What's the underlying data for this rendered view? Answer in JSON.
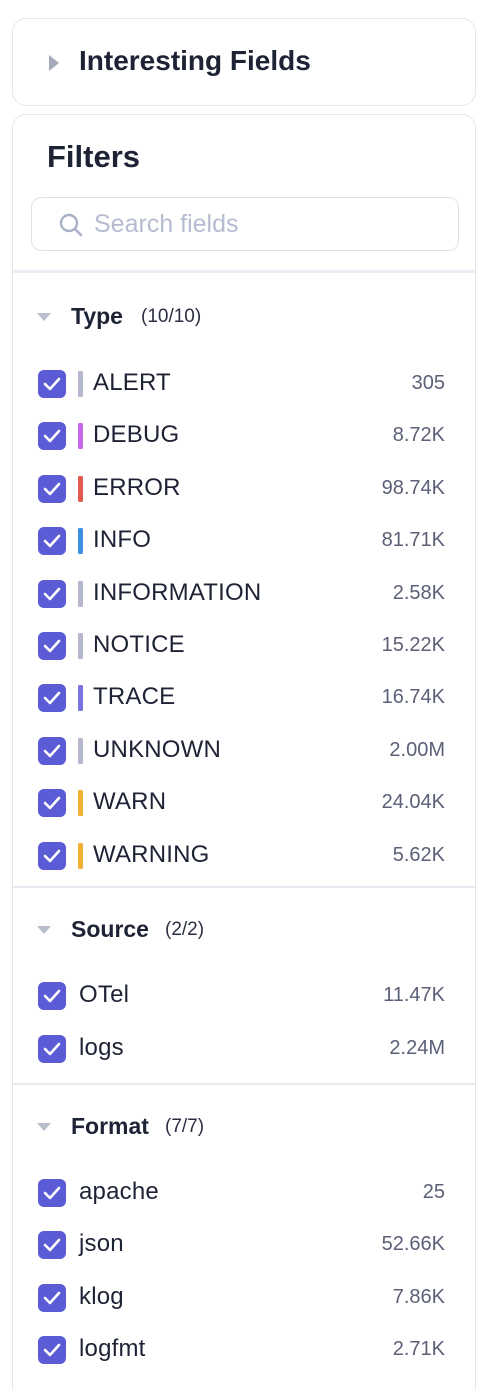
{
  "interesting_fields": {
    "title": "Interesting Fields"
  },
  "filters": {
    "title": "Filters",
    "search": {
      "placeholder": "Search fields",
      "value": ""
    }
  },
  "sections": {
    "type": {
      "label": "Type",
      "count": "(10/10)",
      "items": [
        {
          "label": "ALERT",
          "value": "305",
          "checked": true,
          "color": "#b5b8cc"
        },
        {
          "label": "DEBUG",
          "value": "8.72K",
          "checked": true,
          "color": "#c76ae8"
        },
        {
          "label": "ERROR",
          "value": "98.74K",
          "checked": true,
          "color": "#e05a4f"
        },
        {
          "label": "INFO",
          "value": "81.71K",
          "checked": true,
          "color": "#3f8fe0"
        },
        {
          "label": "INFORMATION",
          "value": "2.58K",
          "checked": true,
          "color": "#b5b8cc"
        },
        {
          "label": "NOTICE",
          "value": "15.22K",
          "checked": true,
          "color": "#b5b8cc"
        },
        {
          "label": "TRACE",
          "value": "16.74K",
          "checked": true,
          "color": "#7a74e0"
        },
        {
          "label": "UNKNOWN",
          "value": "2.00M",
          "checked": true,
          "color": "#b5b8cc"
        },
        {
          "label": "WARN",
          "value": "24.04K",
          "checked": true,
          "color": "#f0b233"
        },
        {
          "label": "WARNING",
          "value": "5.62K",
          "checked": true,
          "color": "#f0b233"
        }
      ]
    },
    "source": {
      "label": "Source",
      "count": "(2/2)",
      "items": [
        {
          "label": "OTel",
          "value": "11.47K",
          "checked": true
        },
        {
          "label": "logs",
          "value": "2.24M",
          "checked": true
        }
      ]
    },
    "format": {
      "label": "Format",
      "count": "(7/7)",
      "items": [
        {
          "label": "apache",
          "value": "25",
          "checked": true
        },
        {
          "label": "json",
          "value": "52.66K",
          "checked": true
        },
        {
          "label": "klog",
          "value": "7.86K",
          "checked": true
        },
        {
          "label": "logfmt",
          "value": "2.71K",
          "checked": true
        }
      ]
    }
  },
  "colors": {
    "accent": "#5b5bd6"
  }
}
